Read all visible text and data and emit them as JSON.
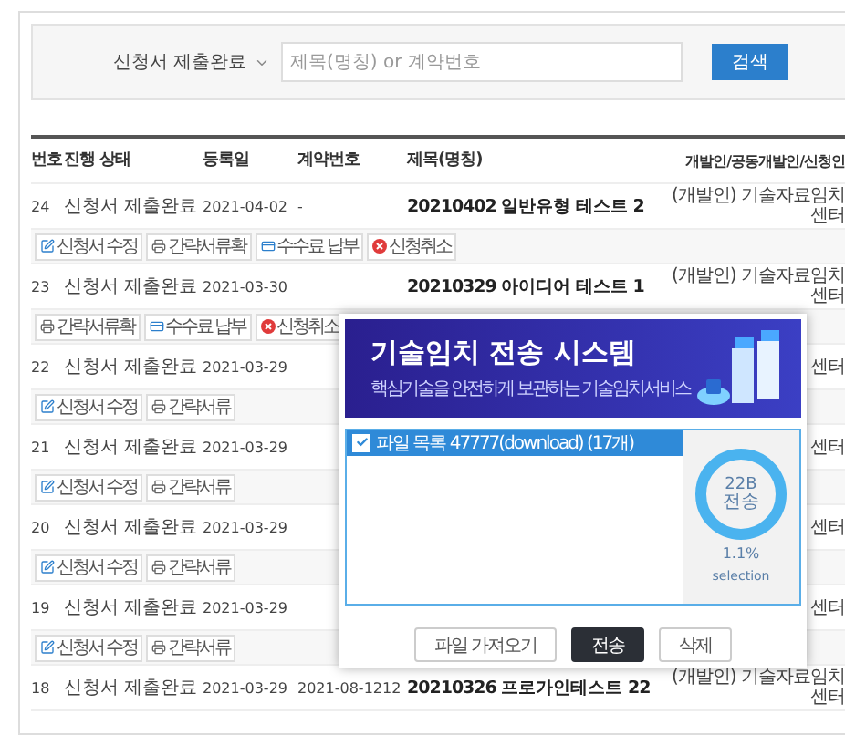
{
  "search": {
    "status_select": "신청서 제출완료",
    "placeholder": "제목(명칭) or 계약번호",
    "button": "검색"
  },
  "table": {
    "columns": [
      "번호",
      "진행 상태",
      "등록일",
      "계약번호",
      "제목(명칭)",
      "개발인/공동개발인/신청인"
    ],
    "rows": [
      {
        "no": "24",
        "status": "신청서 제출완료",
        "date": "2021-04-02",
        "contract": "-",
        "title": "20210402 일반유형 테스트 2",
        "owner": "(개발인) 기술자료임치센터",
        "actions": [
          {
            "kind": "edit",
            "label": "신청서 수정"
          },
          {
            "kind": "doc",
            "label": "간략서류확"
          },
          {
            "kind": "pay",
            "label": "수수료 납부"
          },
          {
            "kind": "cancel",
            "label": "신청취소"
          }
        ]
      },
      {
        "no": "23",
        "status": "신청서 제출완료",
        "date": "2021-03-30",
        "title": "20210329 아이디어 테스트 1",
        "owner": "(개발인) 기술자료임치센터",
        "actions": [
          {
            "kind": "doc",
            "label": "간략서류확"
          },
          {
            "kind": "pay",
            "label": "수수료 납부"
          },
          {
            "kind": "cancel",
            "label": "신청취소"
          }
        ]
      },
      {
        "no": "22",
        "status": "신청서 제출완료",
        "date": "2021-03-29",
        "owner": "센터",
        "actions": [
          {
            "kind": "edit",
            "label": "신청서 수정"
          },
          {
            "kind": "doc",
            "label": "간략서류"
          }
        ]
      },
      {
        "no": "21",
        "status": "신청서 제출완료",
        "date": "2021-03-29",
        "owner": "센터",
        "actions": [
          {
            "kind": "edit",
            "label": "신청서 수정"
          },
          {
            "kind": "doc",
            "label": "간략서류"
          }
        ]
      },
      {
        "no": "20",
        "status": "신청서 제출완료",
        "date": "2021-03-29",
        "owner": "센터",
        "actions": [
          {
            "kind": "edit",
            "label": "신청서 수정"
          },
          {
            "kind": "doc",
            "label": "간략서류"
          }
        ]
      },
      {
        "no": "19",
        "status": "신청서 제출완료",
        "date": "2021-03-29",
        "owner": "센터",
        "actions": [
          {
            "kind": "edit",
            "label": "신청서 수정"
          },
          {
            "kind": "doc",
            "label": "간략서류"
          }
        ]
      },
      {
        "no": "18",
        "status": "신청서 제출완료",
        "date": "2021-03-29",
        "contract": "2021-08-1212",
        "title": "20210326 프로가인테스트 22",
        "owner": "(개발인) 기술자료임치센터"
      }
    ]
  },
  "modal": {
    "banner_title": "기술임치 전송 시스템",
    "banner_subtitle": "핵심기술을 안전하게 보관하는 기술임치서비스",
    "file_list": {
      "checked": true,
      "header": "파일 목록 47777(download) (17개)"
    },
    "usage": {
      "value": "22B",
      "unit": "전송",
      "percent": "1.1%",
      "caption": "selection"
    },
    "buttons": [
      {
        "kind": "default",
        "label": "파일 가져오기"
      },
      {
        "kind": "primary",
        "label": "전송"
      },
      {
        "kind": "default",
        "label": "삭제"
      }
    ]
  }
}
